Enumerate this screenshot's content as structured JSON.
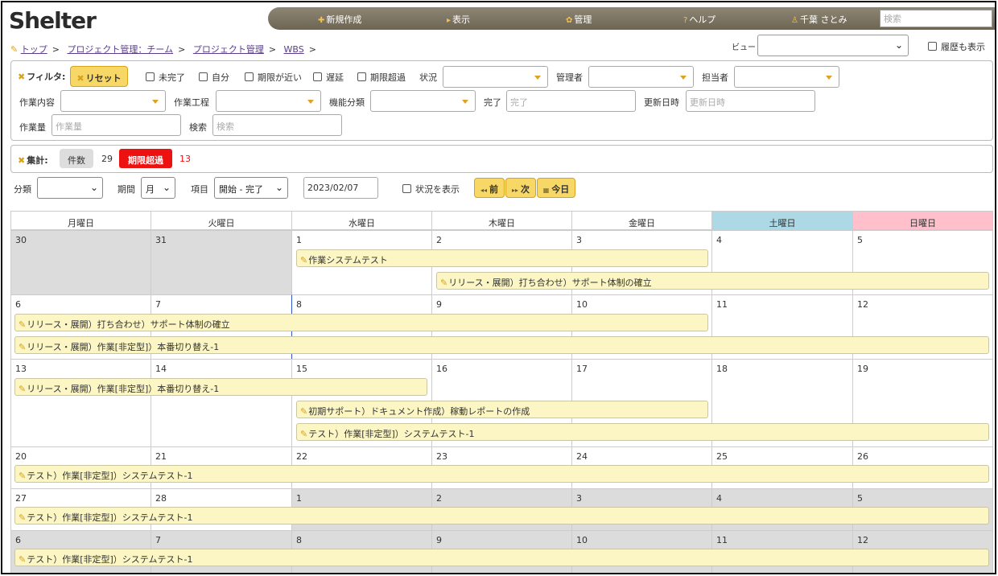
{
  "app": {
    "logo": "Shelter"
  },
  "nav": {
    "new": "新規作成",
    "view": "表示",
    "admin": "管理",
    "help": "ヘルプ",
    "user": "千葉 さとみ",
    "search_placeholder": "検索"
  },
  "breadcrumb": [
    "トップ",
    "プロジェクト管理：チーム",
    "プロジェクト管理",
    "WBS"
  ],
  "view_label": "ビュー",
  "history_label": "履歴も表示",
  "filter": {
    "title": "フィルタ:",
    "reset": "リセット",
    "checks": [
      "未完了",
      "自分",
      "期限が近い",
      "遅延",
      "期限超過"
    ],
    "status": "状況",
    "manager": "管理者",
    "assignee": "担当者",
    "work_content": "作業内容",
    "work_process": "作業工程",
    "function_class": "機能分類",
    "done": "完了",
    "done_placeholder": "完了",
    "updated": "更新日時",
    "updated_placeholder": "更新日時",
    "volume": "作業量",
    "volume_placeholder": "作業量",
    "search": "検索",
    "search_placeholder": "検索"
  },
  "summary": {
    "title": "集計:",
    "count_label": "件数",
    "count": "29",
    "overdue_label": "期限超過",
    "overdue": "13"
  },
  "toolbar": {
    "category": "分類",
    "period": "期間",
    "period_value": "月",
    "item": "項目",
    "item_value": "開始 - 完了",
    "date": "2023/02/07",
    "show_status": "状況を表示",
    "prev": "前",
    "next": "次",
    "today": "今日"
  },
  "weekdays": [
    "月曜日",
    "火曜日",
    "水曜日",
    "木曜日",
    "金曜日",
    "土曜日",
    "日曜日"
  ],
  "weeks": [
    [
      "30",
      "31",
      "1",
      "2",
      "3",
      "4",
      "5"
    ],
    [
      "6",
      "7",
      "8",
      "9",
      "10",
      "11",
      "12"
    ],
    [
      "13",
      "14",
      "15",
      "16",
      "17",
      "18",
      "19"
    ],
    [
      "20",
      "21",
      "22",
      "23",
      "24",
      "25",
      "26"
    ],
    [
      "27",
      "28",
      "1",
      "2",
      "3",
      "4",
      "5"
    ],
    [
      "6",
      "7",
      "8",
      "9",
      "10",
      "11",
      "12"
    ]
  ],
  "events": [
    "作業システムテスト",
    "リリース・展開）打ち合わせ）サポート体制の確立",
    "リリース・展開）打ち合わせ）サポート体制の確立",
    "リリース・展開）作業[非定型]）本番切り替え-1",
    "リリース・展開）作業[非定型]）本番切り替え-1",
    "初期サポート）ドキュメント作成）稼動レポートの作成",
    "テスト）作業[非定型]）システムテスト-1",
    "テスト）作業[非定型]）システムテスト-1",
    "テスト）作業[非定型]）システムテスト-1",
    "テスト）作業[非定型]）システムテスト-1"
  ],
  "colors": {
    "saturday": "#add8e6",
    "sunday": "#ffc0cb",
    "accent": "#f7d766",
    "overdue": "#ee1111"
  }
}
